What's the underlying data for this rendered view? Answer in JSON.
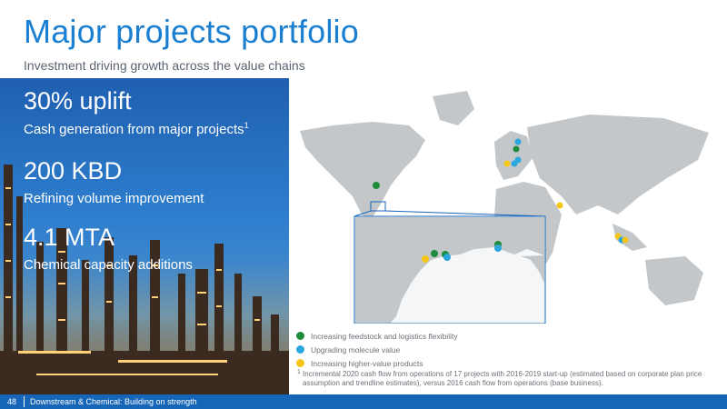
{
  "header": {
    "title": "Major projects portfolio",
    "subtitle": "Investment driving growth across the value chains"
  },
  "stats": [
    {
      "value": "30% uplift",
      "label": "Cash generation from major projects",
      "footnote_ref": "1"
    },
    {
      "value": "200 KBD",
      "label": "Refining volume improvement"
    },
    {
      "value": "4.1 MTA",
      "label": "Chemical capacity additions"
    }
  ],
  "legend": [
    {
      "label": "Increasing feedstock and logistics flexibility",
      "color": "#1e8c3a"
    },
    {
      "label": "Upgrading molecule value",
      "color": "#2aa7df"
    },
    {
      "label": "Increasing higher-value products",
      "color": "#f5c518"
    }
  ],
  "footnote": {
    "mark": "1",
    "text": "Incremental 2020 cash flow from operations of 17 projects with 2016-2019 start-up (estimated based on corporate plan price assumption and trendline estimates), versus 2016 cash flow from operations (base business)."
  },
  "footer": {
    "page": "48",
    "text": "Downstream & Chemical: Building on strength"
  },
  "colors": {
    "accent": "#1a7fd0",
    "footer_bg": "#1565b8",
    "land": "#c4c7ca",
    "feedstock": "#1e8c3a",
    "upgrading": "#2aa7df",
    "higher_value": "#f5c518"
  }
}
